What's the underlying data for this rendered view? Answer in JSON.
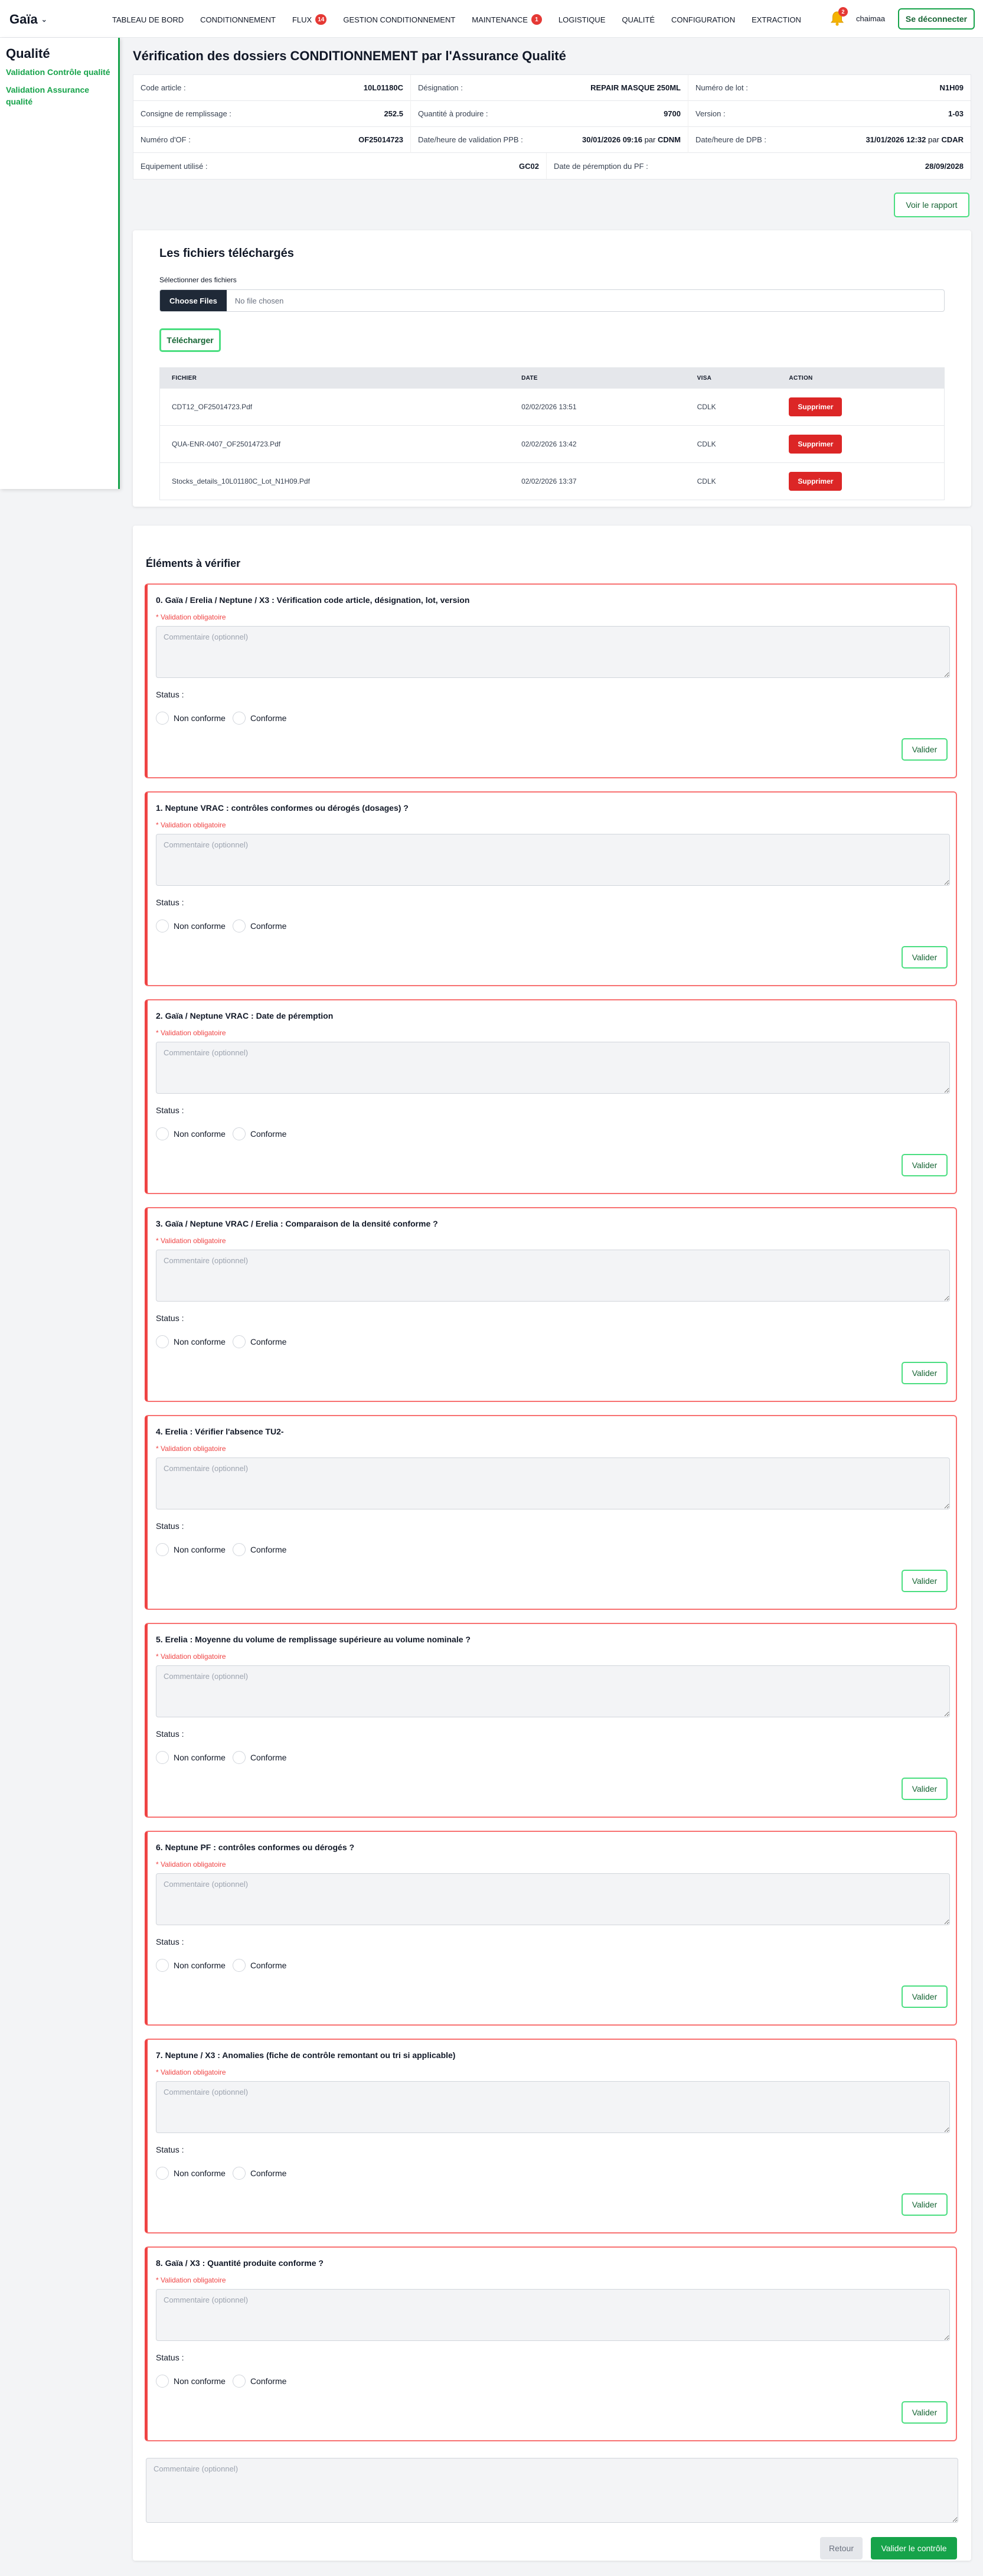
{
  "app": {
    "brand": "Gaïa"
  },
  "nav": {
    "items": [
      {
        "label": "TABLEAU DE BORD"
      },
      {
        "label": "CONDITIONNEMENT"
      },
      {
        "label": "FLUX",
        "badge": "14"
      },
      {
        "label": "GESTION CONDITIONNEMENT"
      },
      {
        "label": "MAINTENANCE",
        "badge": "1"
      },
      {
        "label": "LOGISTIQUE"
      },
      {
        "label": "QUALITÉ"
      },
      {
        "label": "CONFIGURATION"
      },
      {
        "label": "EXTRACTION"
      }
    ],
    "notifications_count": "2",
    "username": "chaimaa",
    "logout_label": "Se déconnecter"
  },
  "sidebar": {
    "title": "Qualité",
    "links": [
      {
        "label": "Validation Contrôle qualité"
      },
      {
        "label": "Validation Assurance qualité"
      }
    ]
  },
  "page": {
    "title": "Vérification des dossiers CONDITIONNEMENT par l'Assurance Qualité"
  },
  "info": {
    "code_article": {
      "label": "Code article :",
      "value": "10L01180C"
    },
    "designation": {
      "label": "Désignation :",
      "value": "REPAIR MASQUE 250ML"
    },
    "numero_lot": {
      "label": "Numéro de lot :",
      "value": "N1H09"
    },
    "consigne": {
      "label": "Consigne de remplissage :",
      "value": "252.5"
    },
    "quantite": {
      "label": "Quantité à produire :",
      "value": "9700"
    },
    "version": {
      "label": "Version :",
      "value": "1-03"
    },
    "numero_of": {
      "label": "Numéro d'OF :",
      "value": "OF25014723"
    },
    "validation_ppb": {
      "label": "Date/heure de validation PPB :",
      "value": "30/01/2026 09:16",
      "par": "par",
      "by": "CDNM"
    },
    "dpb": {
      "label": "Date/heure de DPB :",
      "value": "31/01/2026 12:32",
      "par": "par",
      "by": "CDAR"
    },
    "equipement": {
      "label": "Equipement utilisé :",
      "value": "GC02"
    },
    "peremption": {
      "label": "Date de péremption du PF :",
      "value": "28/09/2028"
    }
  },
  "actions": {
    "voir_rapport": "Voir le rapport"
  },
  "files": {
    "title": "Les fichiers téléchargés",
    "select_label": "Sélectionner des fichiers",
    "choose_label": "Choose Files",
    "no_file": "No file chosen",
    "upload_label": "Télécharger",
    "columns": [
      "FICHIER",
      "DATE",
      "VISA",
      "ACTION"
    ],
    "delete_label": "Supprimer",
    "rows": [
      {
        "file": "CDT12_OF25014723.Pdf",
        "date": "02/02/2026 13:51",
        "visa": "CDLK"
      },
      {
        "file": "QUA-ENR-0407_OF25014723.Pdf",
        "date": "02/02/2026 13:42",
        "visa": "CDLK"
      },
      {
        "file": "Stocks_details_10L01180C_Lot_N1H09.Pdf",
        "date": "02/02/2026 13:37",
        "visa": "CDLK"
      }
    ]
  },
  "elements": {
    "title": "Éléments à vérifier",
    "required_label": "* Validation obligatoire",
    "comment_placeholder": "Commentaire (optionnel)",
    "status_label": "Status :",
    "non_conforme": "Non conforme",
    "conforme": "Conforme",
    "valider_label": "Valider",
    "items": [
      {
        "title": "0. Gaïa / Erelia / Neptune / X3 : Vérification code article, désignation, lot, version"
      },
      {
        "title": "1. Neptune VRAC : contrôles conformes ou dérogés (dosages) ?"
      },
      {
        "title": "2. Gaïa / Neptune VRAC : Date de péremption"
      },
      {
        "title": "3. Gaïa / Neptune VRAC / Erelia : Comparaison de la densité conforme ?"
      },
      {
        "title": "4. Erelia : Vérifier l'absence TU2-"
      },
      {
        "title": "5. Erelia : Moyenne du volume de remplissage supérieure au volume nominale ?"
      },
      {
        "title": "6. Neptune PF : contrôles conformes ou dérogés ?"
      },
      {
        "title": "7. Neptune / X3 : Anomalies (fiche de contrôle remontant ou tri si applicable)"
      },
      {
        "title": "8. Gaïa / X3 : Quantité produite conforme ?"
      }
    ]
  },
  "footer": {
    "comment_placeholder": "Commentaire (optionnel)",
    "retour_label": "Retour",
    "valider_controle_label": "Valider le contrôle"
  }
}
